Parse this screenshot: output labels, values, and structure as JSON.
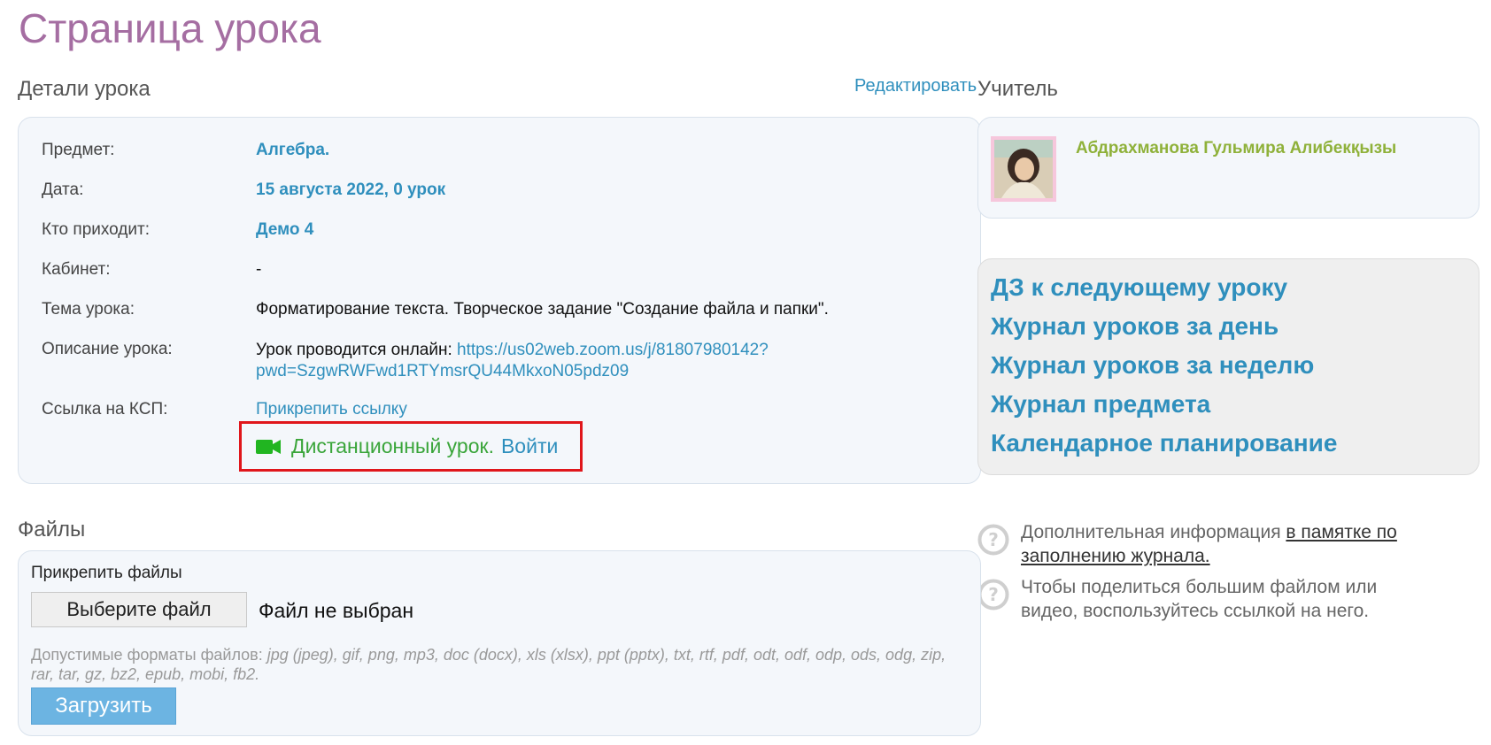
{
  "page": {
    "title": "Страница урока"
  },
  "details": {
    "title": "Детали урока",
    "edit_label": "Редактировать",
    "rows": {
      "subject": {
        "label": "Предмет:",
        "value": "Алгебра."
      },
      "date": {
        "label": "Дата:",
        "value": "15 августа 2022, 0 урок"
      },
      "attendees": {
        "label": "Кто приходит:",
        "value": "Демо 4"
      },
      "room": {
        "label": "Кабинет:",
        "value": "-"
      },
      "topic": {
        "label": "Тема урока:",
        "value": "Форматирование текста. Творческое задание \"Создание файла и папки\"."
      },
      "description": {
        "label": "Описание урока:",
        "prefix": "Урок проводится онлайн:",
        "link_line1": "https://us02web.zoom.us/j/81807980142?",
        "link_line2": "pwd=SzgwRWFwd1RTYmsrQU44MkxoN05pdz09"
      },
      "ksp": {
        "label": "Ссылка на КСП:",
        "value": "Прикрепить ссылку"
      }
    },
    "remote": {
      "text": "Дистанционный урок.",
      "join_label": "Войти",
      "icon": "video-camera-icon",
      "icon_color": "#21b521"
    }
  },
  "teacher": {
    "title": "Учитель",
    "name": "Абдрахманова Гульмира Алибекқызы"
  },
  "quick_links": [
    "ДЗ к следующему уроку",
    "Журнал уроков за день",
    "Журнал уроков за неделю",
    "Журнал предмета",
    "Календарное планирование"
  ],
  "help": {
    "item1_prefix": "Дополнительная информация",
    "item1_link": "в памятке по заполнению журнала.",
    "item2": "Чтобы поделиться большим файлом или видео, воспользуйтесь ссылкой на него."
  },
  "files": {
    "title": "Файлы",
    "attach_label": "Прикрепить файлы",
    "choose_button": "Выберите файл",
    "no_file": "Файл не выбран",
    "formats_prefix": "Допустимые форматы файлов:",
    "formats_list": "jpg (jpeg), gif, png, mp3, doc (docx), xls (xlsx), ppt (pptx), txt, rtf, pdf, odt, odf, odp, ods, odg, zip, rar, tar, gz, bz2, epub, mobi, fb2.",
    "upload_button": "Загрузить"
  },
  "colors": {
    "title": "#a56ea2",
    "link": "#2f8fbd",
    "teacher_name": "#8fb13a",
    "remote_text": "#3aa53a",
    "highlight_border": "#e0161b"
  }
}
